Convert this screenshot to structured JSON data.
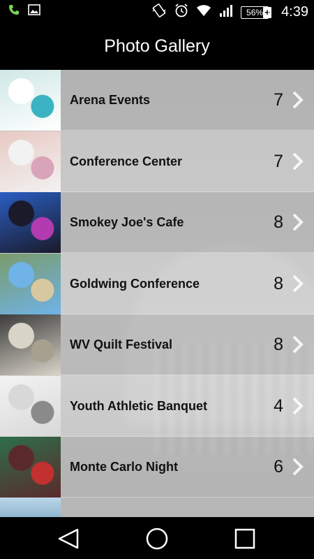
{
  "status_bar": {
    "time": "4:39",
    "battery_percent": "56%",
    "icons": [
      "phone-icon",
      "image-icon",
      "vibrate-icon",
      "alarm-icon",
      "wifi-icon",
      "signal-icon",
      "battery-icon"
    ]
  },
  "app_bar": {
    "title": "Photo Gallery"
  },
  "gallery": {
    "items": [
      {
        "label": "Arena Events",
        "count": "7",
        "thumb": [
          "#ffffff",
          "#3bb3c3",
          "#cfe8e6"
        ]
      },
      {
        "label": "Conference Center",
        "count": "7",
        "thumb": [
          "#f2f2f2",
          "#d9a3b8",
          "#e8c9c3"
        ]
      },
      {
        "label": "Smokey Joe's Cafe",
        "count": "8",
        "thumb": [
          "#1a1a2a",
          "#b23bb0",
          "#2a5ec2"
        ]
      },
      {
        "label": "Goldwing Conference",
        "count": "8",
        "thumb": [
          "#6fb3e8",
          "#d8c8a0",
          "#7a9b6a"
        ]
      },
      {
        "label": "WV Quilt Festival",
        "count": "8",
        "thumb": [
          "#d9d4c8",
          "#a6a08f",
          "#3b3b3b"
        ]
      },
      {
        "label": "Youth Athletic Banquet",
        "count": "4",
        "thumb": [
          "#d8d8d8",
          "#8a8a8a",
          "#f3f3f3"
        ]
      },
      {
        "label": "Monte Carlo Night",
        "count": "6",
        "thumb": [
          "#5a2a2a",
          "#c23030",
          "#2e6e4a"
        ]
      }
    ]
  },
  "nav_bar": {
    "buttons": [
      "back-icon",
      "home-icon",
      "recents-icon"
    ]
  }
}
